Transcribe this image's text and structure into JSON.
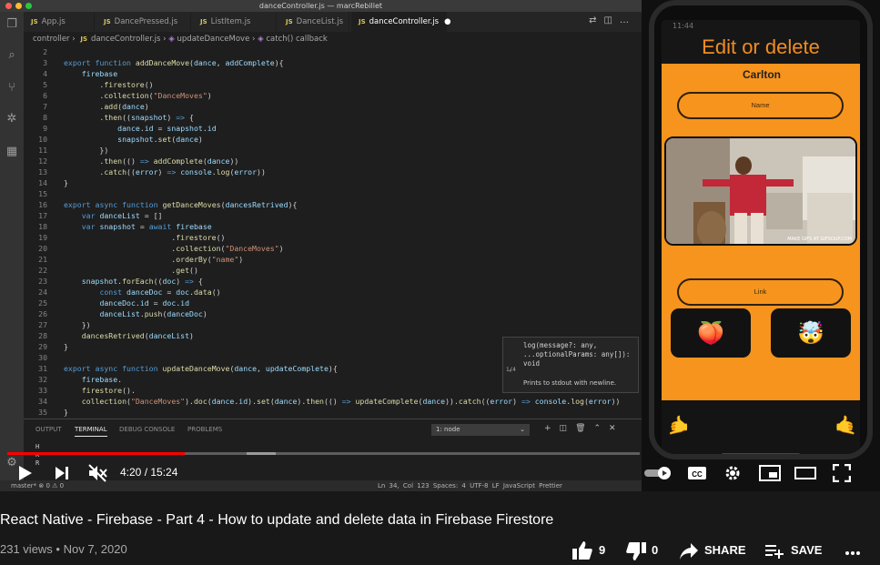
{
  "window": {
    "title": "danceController.js — marcRebillet"
  },
  "tabs": [
    {
      "label": "App.js",
      "icon": "JS"
    },
    {
      "label": "DancePressed.js",
      "icon": "JS"
    },
    {
      "label": "ListItem.js",
      "icon": "JS"
    },
    {
      "label": "DanceList.js",
      "icon": "JS"
    },
    {
      "label": "danceController.js",
      "icon": "JS",
      "active": true,
      "modified_dot": "●"
    }
  ],
  "breadcrumb": {
    "part1": "controller",
    "sep": "›",
    "file": "danceController.js",
    "func": "updateDanceMove",
    "scope": "catch() callback"
  },
  "code_lines": [
    {
      "n": "2",
      "html": ""
    },
    {
      "n": "3",
      "html": "<span class='k'>export</span> <span class='k'>function</span> <span class='f'>addDanceMove</span>(<span class='v'>dance</span>, <span class='v'>addComplete</span>){"
    },
    {
      "n": "4",
      "html": "    <span class='v'>firebase</span>"
    },
    {
      "n": "5",
      "html": "        .<span class='f'>firestore</span>()"
    },
    {
      "n": "6",
      "html": "        .<span class='f'>collection</span>(<span class='s'>\"DanceMoves\"</span>)"
    },
    {
      "n": "7",
      "html": "        .<span class='f'>add</span>(<span class='v'>dance</span>)"
    },
    {
      "n": "8",
      "html": "        .<span class='f'>then</span>((<span class='v'>snapshot</span>) <span class='k'>=&gt;</span> {"
    },
    {
      "n": "9",
      "html": "            <span class='v'>dance</span>.<span class='v'>id</span> = <span class='v'>snapshot</span>.<span class='v'>id</span>"
    },
    {
      "n": "10",
      "html": "            <span class='v'>snapshot</span>.<span class='f'>set</span>(<span class='v'>dance</span>)"
    },
    {
      "n": "11",
      "html": "        })"
    },
    {
      "n": "12",
      "html": "        .<span class='f'>then</span>(() <span class='k'>=&gt;</span> <span class='f'>addComplete</span>(<span class='v'>dance</span>))"
    },
    {
      "n": "13",
      "html": "        .<span class='f'>catch</span>((<span class='v'>error</span>) <span class='k'>=&gt;</span> <span class='v'>console</span>.<span class='f'>log</span>(<span class='v'>error</span>))"
    },
    {
      "n": "14",
      "html": "}"
    },
    {
      "n": "15",
      "html": ""
    },
    {
      "n": "16",
      "html": "<span class='k'>export</span> <span class='k'>async</span> <span class='k'>function</span> <span class='f'>getDanceMoves</span>(<span class='v'>dancesRetrived</span>){"
    },
    {
      "n": "17",
      "html": "    <span class='k'>var</span> <span class='v'>danceList</span> = []"
    },
    {
      "n": "18",
      "html": "    <span class='k'>var</span> <span class='v'>snapshot</span> = <span class='k'>await</span> <span class='v'>firebase</span>"
    },
    {
      "n": "19",
      "html": "                        .<span class='f'>firestore</span>()"
    },
    {
      "n": "20",
      "html": "                        .<span class='f'>collection</span>(<span class='s'>\"DanceMoves\"</span>)"
    },
    {
      "n": "21",
      "html": "                        .<span class='f'>orderBy</span>(<span class='s'>\"name\"</span>)"
    },
    {
      "n": "22",
      "html": "                        .<span class='f'>get</span>()"
    },
    {
      "n": "23",
      "html": "    <span class='v'>snapshot</span>.<span class='f'>forEach</span>((<span class='v'>doc</span>) <span class='k'>=&gt;</span> {"
    },
    {
      "n": "24",
      "html": "        <span class='k'>const</span> <span class='v'>danceDoc</span> = <span class='v'>doc</span>.<span class='f'>data</span>()"
    },
    {
      "n": "25",
      "html": "        <span class='v'>danceDoc</span>.<span class='v'>id</span> = <span class='v'>doc</span>.<span class='v'>id</span>"
    },
    {
      "n": "26",
      "html": "        <span class='v'>danceList</span>.<span class='f'>push</span>(<span class='v'>danceDoc</span>)"
    },
    {
      "n": "27",
      "html": "    })"
    },
    {
      "n": "28",
      "html": "    <span class='f'>dancesRetrived</span>(<span class='v'>danceList</span>)"
    },
    {
      "n": "29",
      "html": "}"
    },
    {
      "n": "30",
      "html": ""
    },
    {
      "n": "31",
      "html": "<span class='k'>export</span> <span class='k'>async</span> <span class='k'>function</span> <span class='f'>updateDanceMove</span>(<span class='v'>dance</span>, <span class='v'>updateComplete</span>){"
    },
    {
      "n": "32",
      "html": "    <span class='v'>firebase</span>."
    },
    {
      "n": "33",
      "html": "    <span class='f'>firestore</span>()."
    },
    {
      "n": "34",
      "html": "    <span class='f'>collection</span>(<span class='s'>\"DanceMoves\"</span>).<span class='f'>doc</span>(<span class='v'>dance</span>.<span class='v'>id</span>).<span class='f'>set</span>(<span class='v'>dance</span>).<span class='f'>then</span>(() <span class='k'>=&gt;</span> <span class='f'>updateComplete</span>(<span class='v'>dance</span>)).<span class='f'>catch</span>((<span class='v'>error</span>) <span class='k'>=&gt;</span> <span class='v'>console</span>.<span class='f'>log</span>(<span class='v'>error</span>))"
    },
    {
      "n": "35",
      "html": "}"
    }
  ],
  "hover": {
    "signature": "log(message?: any,\n...optionalParams: any[]):\nvoid",
    "count": "1/4",
    "doc": "Prints to  stdout  with newline."
  },
  "panel": {
    "tabs": [
      "OUTPUT",
      "TERMINAL",
      "DEBUG CONSOLE",
      "PROBLEMS"
    ],
    "active_tab": "TERMINAL",
    "terminal_select": "1: node",
    "terminal_lines": [
      "H",
      "K",
      "R"
    ]
  },
  "statusbar": {
    "left": "master*   ⊗ 0 ⚠ 0",
    "right": "Ln 34, Col 123   Spaces: 4   UTF-8   LF   JavaScript   Prettier"
  },
  "phone": {
    "time": "11:44",
    "title": "Edit or delete",
    "dance_name": "Carlton",
    "name_field": "Name",
    "link_field": "Link",
    "gif_watermark": "MAKE GIFS AT GIFSOUP.COM",
    "emoji_left": "🍑",
    "emoji_right": "🤯",
    "hand_left": "🤙",
    "hand_right": "🤙"
  },
  "player": {
    "current_time": "4:20",
    "duration": "15:24",
    "time_display": "4:20 / 15:24",
    "played_fraction": 0.28,
    "accent_color": "#ff0000"
  },
  "video": {
    "title": "React Native - Firebase - Part 4 - How to update and delete data in Firebase Firestore",
    "meta": "231 views • Nov 7, 2020",
    "likes": "9",
    "dislikes": "0",
    "share_label": "SHARE",
    "save_label": "SAVE"
  }
}
